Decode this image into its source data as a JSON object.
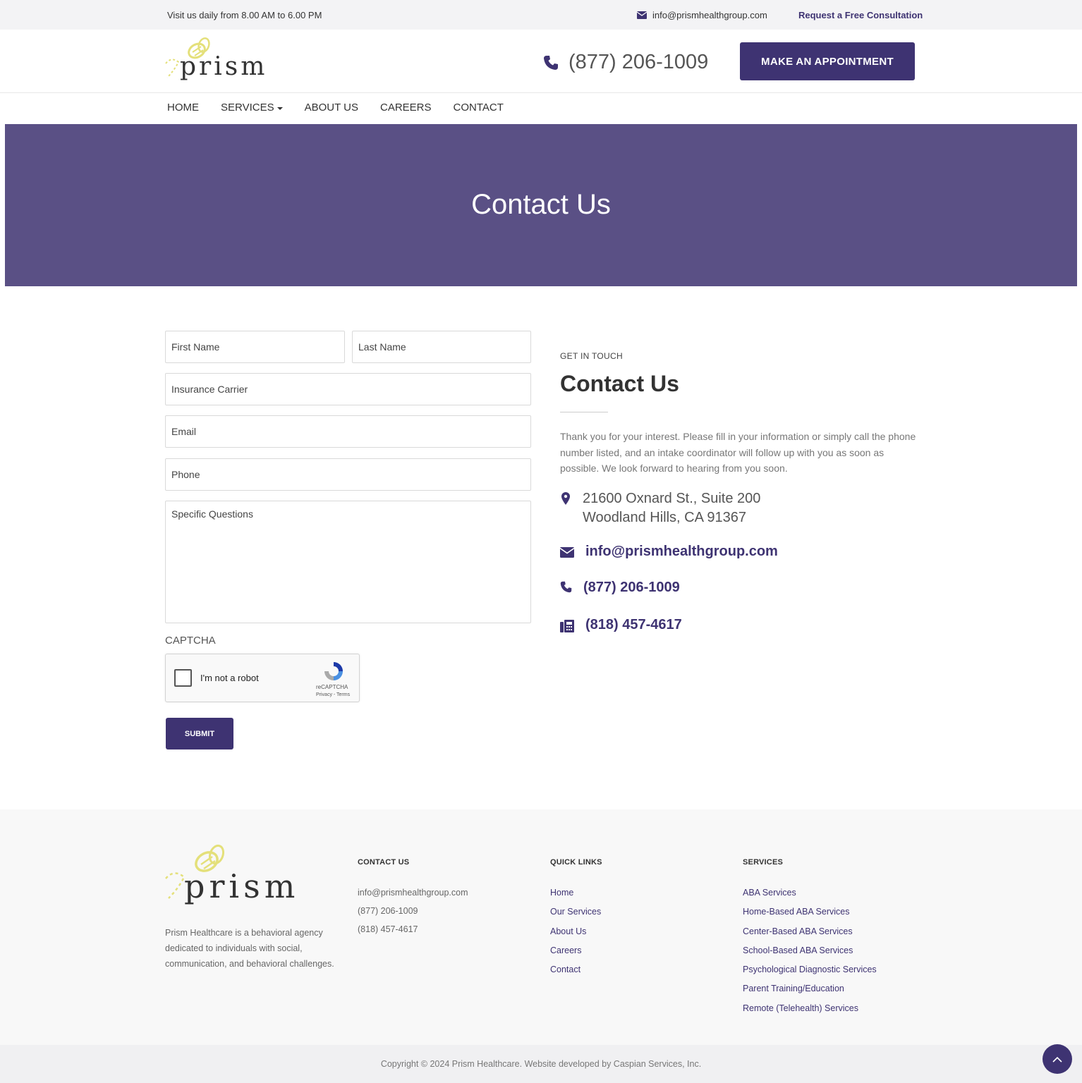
{
  "topbar": {
    "hours": "Visit us daily from 8.00 AM to 6.00 PM",
    "email": "info@prismhealthgroup.com",
    "consultation": "Request a Free Consultation"
  },
  "header": {
    "logo_text": "prism",
    "phone": "(877) 206-1009",
    "appointment_label": "MAKE AN APPOINTMENT"
  },
  "nav": {
    "items": [
      "HOME",
      "SERVICES",
      "ABOUT US",
      "CAREERS",
      "CONTACT"
    ]
  },
  "banner": {
    "title": "Contact Us"
  },
  "form": {
    "first_name": "First Name",
    "last_name": "Last Name",
    "insurance": "Insurance Carrier",
    "email": "Email",
    "phone": "Phone",
    "questions": "Specific Questions",
    "captcha_label": "CAPTCHA",
    "recaptcha_text": "I'm not a robot",
    "recaptcha_brand": "reCAPTCHA",
    "recaptcha_terms": "Privacy - Terms",
    "submit_label": "SUBMIT"
  },
  "contact": {
    "eyebrow": "GET IN TOUCH",
    "title": "Contact Us",
    "description": "Thank you for your interest. Please fill in your information or simply call the phone number listed, and an intake coordinator will follow up with you as soon as possible. We look forward to hearing from you soon.",
    "address_line1": "21600 Oxnard St., Suite 200",
    "address_line2": "Woodland Hills, CA 91367",
    "email": "info@prismhealthgroup.com",
    "phone": "(877) 206-1009",
    "fax": "(818) 457-4617"
  },
  "footer": {
    "logo_text": "prism",
    "about": "Prism Healthcare is a behavioral agency dedicated to individuals with social, communication, and behavioral challenges.",
    "contact_heading": "CONTACT US",
    "contact_items": [
      "info@prismhealthgroup.com",
      "(877) 206-1009",
      "(818) 457-4617"
    ],
    "links_heading": "QUICK LINKS",
    "links": [
      "Home",
      "Our Services",
      "About Us",
      "Careers",
      "Contact"
    ],
    "services_heading": "SERVICES",
    "services": [
      "ABA Services",
      "Home-Based ABA Services",
      "Center-Based ABA Services",
      "School-Based ABA Services",
      "Psychological Diagnostic Services",
      "Parent Training/Education",
      "Remote (Telehealth) Services"
    ],
    "copyright": "Copyright © 2024 Prism Healthcare. Website developed by Caspian Services, Inc."
  },
  "colors": {
    "brand": "#3e3372",
    "banner": "#5a5085",
    "logo_accent": "#e4e07a"
  }
}
